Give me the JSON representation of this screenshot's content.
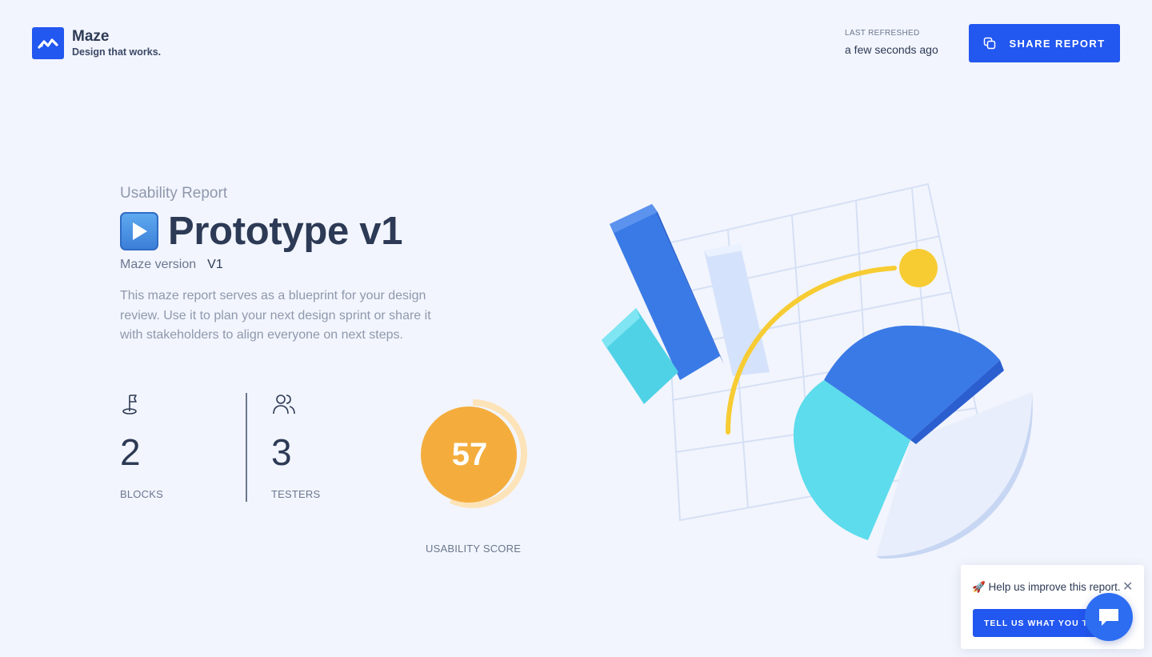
{
  "header": {
    "brand_name": "Maze",
    "brand_tagline": "Design that works.",
    "refresh_label": "LAST REFRESHED",
    "refresh_value": "a few seconds ago",
    "share_label": "SHARE REPORT",
    "share_icon": "copy-icon"
  },
  "report": {
    "subtitle": "Usability Report",
    "title_icon": "play-button-emoji",
    "title": "Prototype v1",
    "version_label": "Maze version",
    "version_value": "V1",
    "description": "This maze report serves as a blueprint for your design review. Use it to plan your next design sprint or share it with stakeholders to align everyone on next steps."
  },
  "stats": {
    "blocks": {
      "icon": "flag-icon",
      "value": "2",
      "label": "BLOCKS"
    },
    "testers": {
      "icon": "users-icon",
      "value": "3",
      "label": "TESTERS"
    }
  },
  "score": {
    "value": 57,
    "value_text": "57",
    "label": "USABILITY SCORE",
    "color": "#f4ad3d",
    "track_color": "#fde3b8"
  },
  "feedback": {
    "icon": "rocket-emoji",
    "text": "🚀 Help us improve this report.",
    "button_label": "TELL US WHAT YOU THINK",
    "close_icon": "close-icon",
    "chat_icon": "chat-bubble-icon"
  },
  "colors": {
    "accent": "#2257f0",
    "background": "#f2f5fd",
    "text_primary": "#2d3a55",
    "text_muted": "#8f98ad"
  }
}
